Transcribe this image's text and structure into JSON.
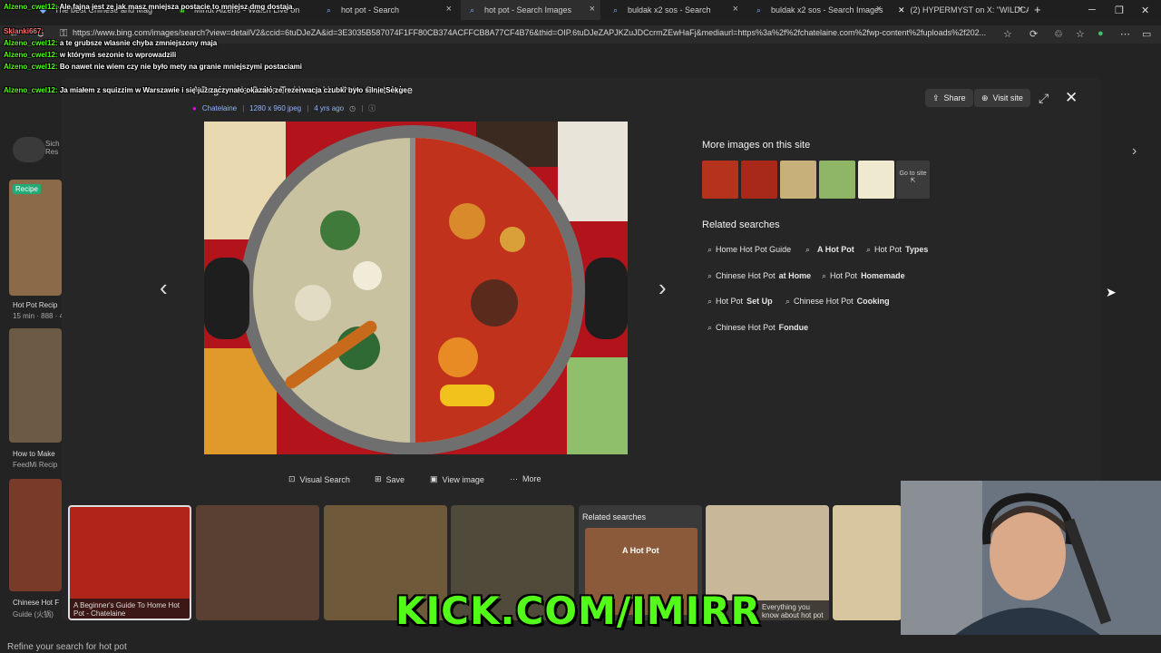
{
  "browser": {
    "tabs": [
      {
        "label": "The best Chinese and Mag"
      },
      {
        "label": "Minut Alzeno - Watch Live on"
      },
      {
        "label": "hot pot - Search"
      },
      {
        "label": "hot pot - Search Images"
      },
      {
        "label": "buldak x2 sos - Search"
      },
      {
        "label": "buldak x2 sos - Search Images"
      },
      {
        "label": "(2) HYPERMYST on X: \"WILDCARD"
      }
    ],
    "new_tab": "+",
    "url": "https://www.bing.com/images/search?view=detailV2&ccid=6tuDJeZA&id=3E3035B587074F1FF80CB374ACFFCB8A77CF4B76&thid=OIP.6tuDJeZAPJKZuJDCcrmZEwHaFj&mediaurl=https%3a%2f%2fchatelaine.com%2fwp-content%2fuploads%2f202..."
  },
  "background_page": {
    "cards": [
      {
        "title": "Hot Pot Recip",
        "meta": "15 min · 888 · 4.7"
      },
      {
        "title": "How to Make",
        "meta": "FeedMi Recip"
      },
      {
        "title": "Chinese Hot F",
        "meta": "Guide (火锅)"
      }
    ],
    "recipe_badge": "Recipe",
    "sichuan_label": "Sich\nRes",
    "refine_text": "Refine your search for hot pot"
  },
  "viewer": {
    "title": "A Beginner's Guide To Home Hot Pot - Chatelaine",
    "source": "Chatelaine",
    "dimensions": "1280 x 960 jpeg",
    "age": "4 yrs ago",
    "share_label": "Share",
    "visit_label": "Visit site",
    "actions": {
      "visual_search": "Visual Search",
      "save": "Save",
      "view_image": "View image",
      "more": "More"
    },
    "more_images_title": "More images on this site",
    "go_to_site": "Go to site",
    "related_title": "Related searches",
    "related": [
      {
        "plain": "Home Hot Pot Guide",
        "bold": ""
      },
      {
        "plain": "",
        "bold": "A Hot Pot"
      },
      {
        "plain": "Hot Pot ",
        "bold": "Types"
      },
      {
        "plain": "Chinese Hot Pot ",
        "bold": "at Home"
      },
      {
        "plain": "Hot Pot ",
        "bold": "Homemade"
      },
      {
        "plain": "Hot Pot ",
        "bold": "Set Up"
      },
      {
        "plain": "Chinese Hot Pot ",
        "bold": "Cooking"
      },
      {
        "plain": "Chinese Hot Pot ",
        "bold": "Fondue"
      }
    ],
    "film": {
      "first_caption": "A Beginner's Guide To Home Hot Pot - Chatelaine",
      "related_title": "Related searches",
      "related_label": "A Hot Pot",
      "sixth_caption": "Everything you know about hot pot"
    }
  },
  "chat": [
    {
      "user": "Alzeno_cwel12:",
      "msg": "Ale fajna jest ze jak masz mniejsza postacie to mniejsz dmg dostaja"
    },
    {
      "user": "",
      "msg": "Sklanki667:"
    },
    {
      "user": "Alzeno_cwel12:",
      "msg": "a te grubsze wlasnie chyba zmniejszony maja"
    },
    {
      "user": "Alzeno_cwel12:",
      "msg": "w którymś sezonie to wprowadzili"
    },
    {
      "user": "Alzeno_cwel12:",
      "msg": "Bo nawet nie wiem czy nie było mety na granie mniejszymi postaciami"
    },
    {
      "user": "Alzeno_cwel12:",
      "msg": "Ja miałem z squizzim w Warszawie i się już zaczynało okazało ze rezerwacja czubki było silnie Sekge"
    }
  ],
  "stream": {
    "banner": "KICK.COM/IMIRR"
  },
  "colors": {
    "kick_green": "#53fc18",
    "overlay_bg": "#262626",
    "page_bg": "#232323"
  }
}
